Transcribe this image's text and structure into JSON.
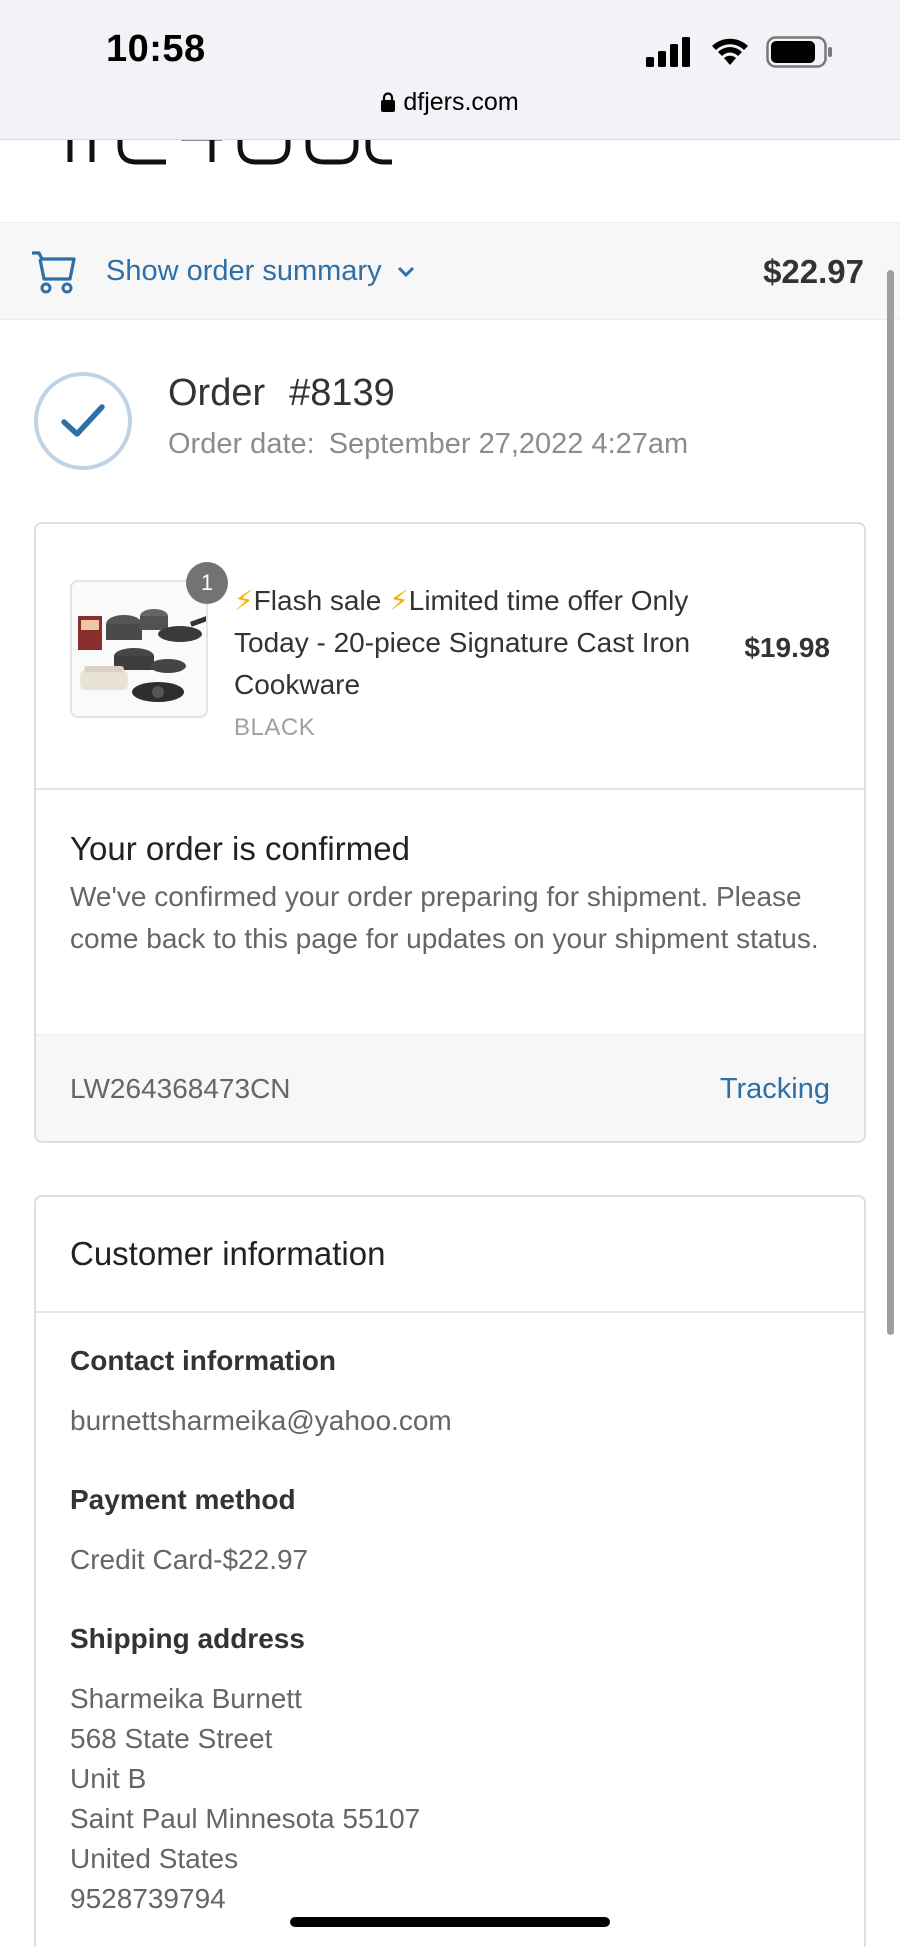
{
  "status_bar": {
    "time": "10:58",
    "url": "dfjers.com"
  },
  "order_summary_bar": {
    "toggle_label": "Show order summary",
    "total": "$22.97"
  },
  "order": {
    "label": "Order",
    "number": "#8139",
    "date_label": "Order date:",
    "date_value": "September 27,2022 4:27am"
  },
  "product": {
    "quantity": "1",
    "name": "⚡Flash sale ⚡Limited time offer Only Today - 20-piece Signature Cast Iron Cookware",
    "variant": "BLACK",
    "price": "$19.98"
  },
  "confirmation": {
    "title": "Your order is confirmed",
    "message": "We've confirmed your order preparing for shipment. Please come back to this page for updates on your shipment status.",
    "tracking_number": "LW264368473CN",
    "tracking_link": "Tracking"
  },
  "customer_info": {
    "title": "Customer information",
    "contact_label": "Contact information",
    "contact_value": "burnettsharmeika@yahoo.com",
    "payment_label": "Payment method",
    "payment_value": "Credit Card-$22.97",
    "shipping_label": "Shipping address",
    "shipping_lines": [
      "Sharmeika Burnett",
      "568 State Street",
      "Unit B",
      "Saint Paul Minnesota 55107",
      "United States",
      "9528739794"
    ]
  },
  "icons": {
    "cart": "cart-icon",
    "chevron": "chevron-down-icon",
    "check": "checkmark-icon",
    "lock": "lock-icon"
  },
  "colors": {
    "link": "#2f6fa8",
    "bolt": "#f5b300",
    "check_ring": "#bfd3e6",
    "check_mark": "#2f6fa8"
  }
}
